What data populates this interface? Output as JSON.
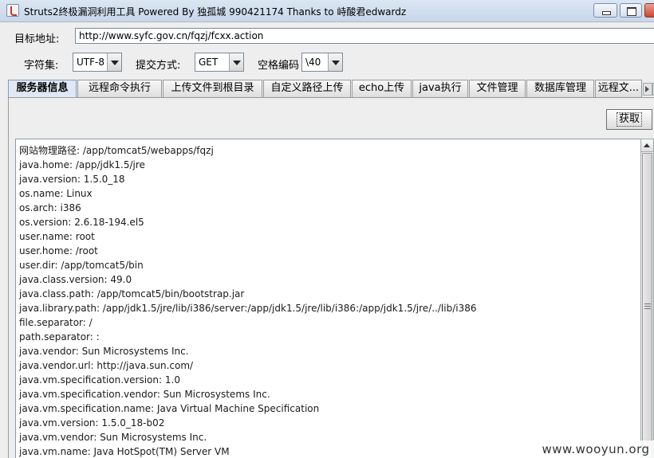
{
  "window": {
    "title": "Struts2终极漏洞利用工具    Powered By 独孤城 990421174 Thanks to 峙酸君edwardz"
  },
  "form": {
    "url_label": "目标地址:",
    "url_value": "http://www.syfc.gov.cn/fqzj/fcxx.action",
    "charset_label": "字符集:",
    "charset_value": "UTF-8",
    "method_label": "提交方式:",
    "method_value": "GET",
    "space_label": "空格编码",
    "space_value": "\\40"
  },
  "tabs": [
    {
      "label": "服务器信息",
      "active": true
    },
    {
      "label": "远程命令执行"
    },
    {
      "label": "上传文件到根目录"
    },
    {
      "label": "自定义路径上传"
    },
    {
      "label": "echo上传"
    },
    {
      "label": "java执行"
    },
    {
      "label": "文件管理"
    },
    {
      "label": "数据库管理"
    },
    {
      "label": "远程文..."
    }
  ],
  "fetch_button": "获取",
  "output_lines": [
    "网站物理路径:  /app/tomcat5/webapps/fqzj",
    "java.home: /app/jdk1.5/jre",
    "java.version: 1.5.0_18",
    "os.name: Linux",
    "os.arch: i386",
    "os.version: 2.6.18-194.el5",
    "user.name: root",
    "user.home: /root",
    "user.dir: /app/tomcat5/bin",
    "java.class.version: 49.0",
    "java.class.path: /app/tomcat5/bin/bootstrap.jar",
    "java.library.path: /app/jdk1.5/jre/lib/i386/server:/app/jdk1.5/jre/lib/i386:/app/jdk1.5/jre/../lib/i386",
    "file.separator: /",
    "path.separator: :",
    "java.vendor: Sun Microsystems Inc.",
    "java.vendor.url: http://java.sun.com/",
    "java.vm.specification.version: 1.0",
    "java.vm.specification.vendor: Sun Microsystems Inc.",
    "java.vm.specification.name: Java Virtual Machine Specification",
    "java.vm.version: 1.5.0_18-b02",
    "java.vm.vendor: Sun Microsystems Inc.",
    "java.vm.name: Java HotSpot(TM) Server VM"
  ],
  "watermark": "www.wooyun.org"
}
